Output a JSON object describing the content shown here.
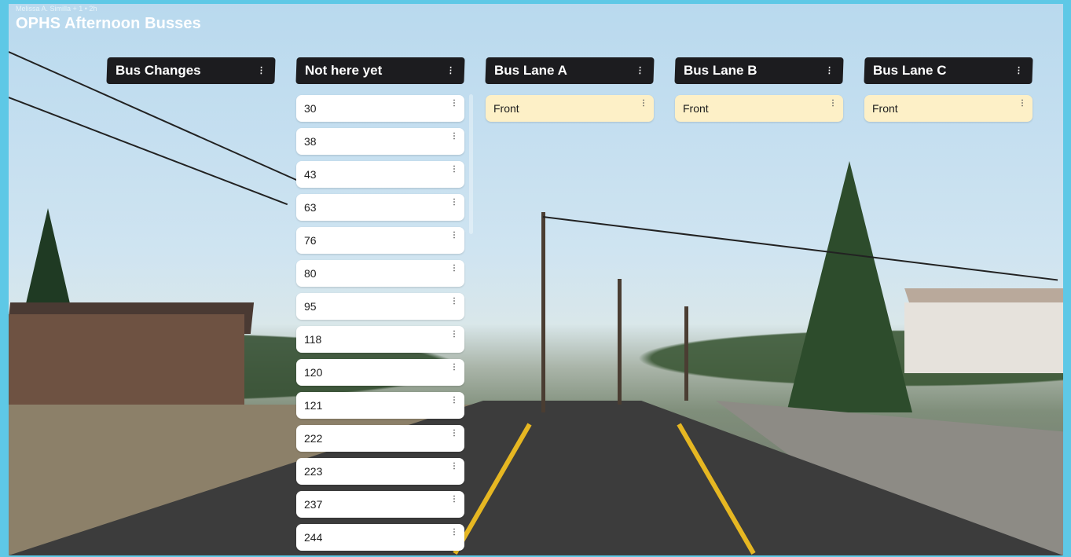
{
  "board": {
    "meta": "Melissa A. Similla + 1 • 2h",
    "title": "OPHS Afternoon Busses"
  },
  "columns": [
    {
      "title": "Bus Changes",
      "cards": []
    },
    {
      "title": "Not here yet",
      "cards": [
        "30",
        "38",
        "43",
        "63",
        "76",
        "80",
        "95",
        "118",
        "120",
        "121",
        "222",
        "223",
        "237",
        "244"
      ]
    },
    {
      "title": "Bus Lane A",
      "cards": [
        "Front"
      ]
    },
    {
      "title": "Bus Lane B",
      "cards": [
        "Front"
      ]
    },
    {
      "title": "Bus Lane C",
      "cards": [
        "Front"
      ]
    }
  ],
  "icons": {
    "column_menu": "more-vertical-icon",
    "card_menu": "more-vertical-icon"
  },
  "colors": {
    "column_header": "#1c1c1f",
    "card": "#ffffff",
    "lane_card": "#fdf0c7",
    "border": "#5ec8e6"
  }
}
